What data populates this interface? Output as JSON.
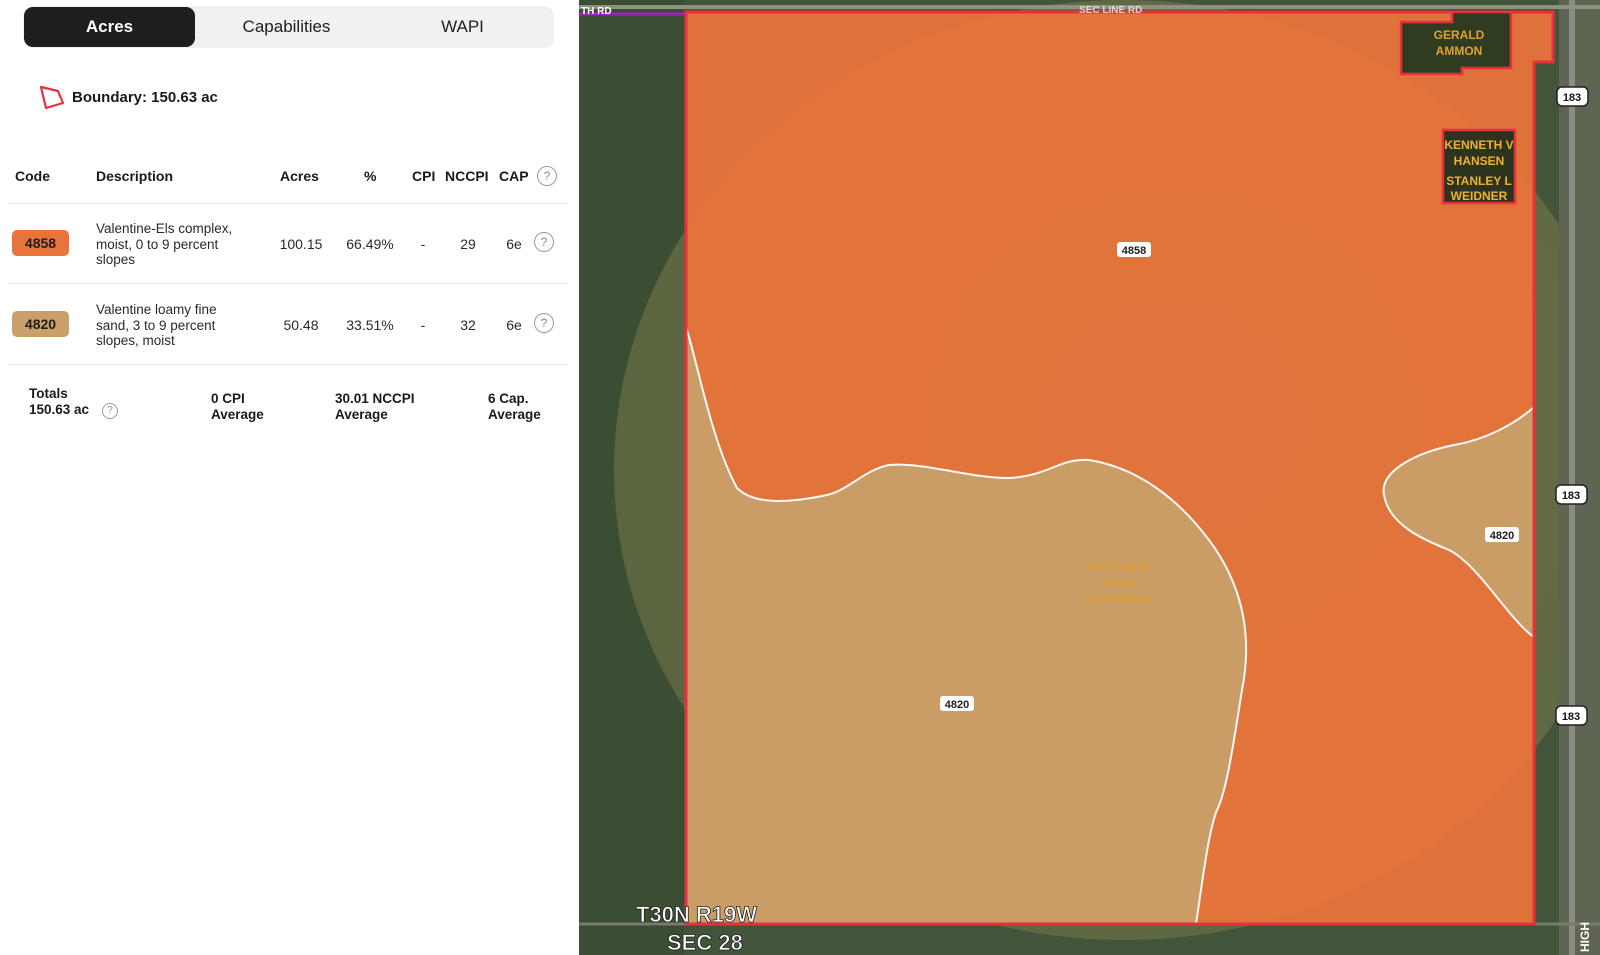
{
  "tabs": [
    {
      "label": "Acres",
      "active": true
    },
    {
      "label": "Capabilities",
      "active": false
    },
    {
      "label": "WAPI",
      "active": false
    }
  ],
  "boundary": {
    "label": "Boundary: 150.63 ac",
    "icon": "polygon-outline-icon"
  },
  "table": {
    "headers": {
      "code": "Code",
      "description": "Description",
      "acres": "Acres",
      "percent": "%",
      "cpi": "CPI",
      "nccpi": "NCCPI",
      "cap": "CAP"
    },
    "rows": [
      {
        "code": "4858",
        "color": "#e8743b",
        "description_lines": [
          "Valentine-Els complex,",
          "moist, 0 to 9 percent",
          "slopes"
        ],
        "acres": "100.15",
        "percent": "66.49%",
        "cpi": "-",
        "nccpi": "29",
        "cap": "6e"
      },
      {
        "code": "4820",
        "color": "#c9a06a",
        "description_lines": [
          "Valentine loamy fine",
          "sand, 3 to 9 percent",
          "slopes, moist"
        ],
        "acres": "50.48",
        "percent": "33.51%",
        "cpi": "-",
        "nccpi": "32",
        "cap": "6e"
      }
    ],
    "totals": {
      "label": "Totals",
      "acres": "150.63 ac",
      "cpi_lines": [
        "0 CPI",
        "Average"
      ],
      "nccpi_lines": [
        "30.01 NCCPI",
        "Average"
      ],
      "cap_lines": [
        "6 Cap.",
        "Average"
      ]
    }
  },
  "map": {
    "zone_labels": [
      "4858",
      "4820",
      "4820"
    ],
    "owner_labels": {
      "gerald_ammon": [
        "GERALD",
        "AMMON"
      ],
      "kenneth_hansen": [
        "KENNETH V",
        "HANSEN"
      ],
      "stanley_weidner": [
        "STANLEY L",
        "WEIDNER"
      ],
      "matthew_popowski": [
        "MATTHEW",
        "JOHN",
        "POPOWSKI"
      ]
    },
    "highway_shields": [
      "183",
      "183",
      "183"
    ],
    "township": "T30N R19W",
    "section": "SEC 28",
    "road_label_side": "HIGH",
    "road_top_left": "TH RD",
    "road_top_mid": "SEC LINE RD",
    "colors": {
      "zone_4858": "#e8743b",
      "zone_4820": "#c9a06a",
      "boundary": "#e8303a"
    }
  }
}
